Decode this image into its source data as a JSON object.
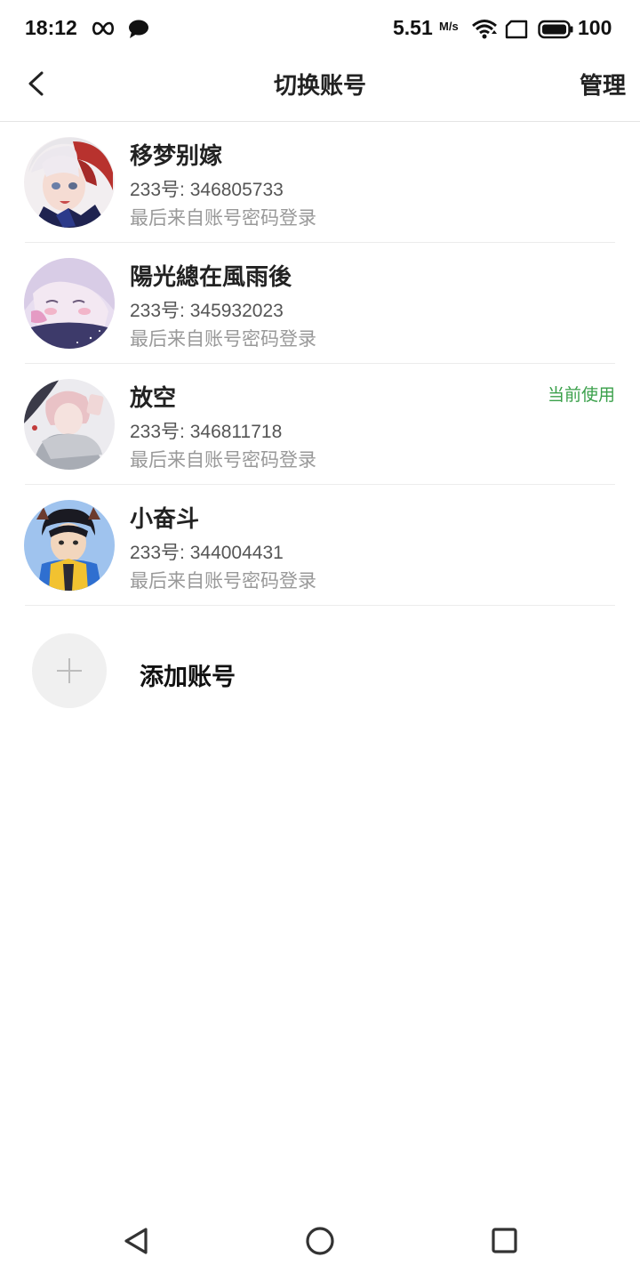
{
  "status_bar": {
    "time": "18:12",
    "speed": "5.51",
    "speed_unit": "M/s",
    "battery": "100",
    "icons": [
      "infinity-icon",
      "chat-bubble-icon",
      "wifi-icon",
      "sim-card-icon",
      "battery-icon"
    ]
  },
  "header": {
    "title": "切换账号",
    "manage_label": "管理",
    "back_icon": "chevron-left-icon"
  },
  "accounts": [
    {
      "name": "移梦别嫁",
      "id_text": "233号: 346805733",
      "login_text": "最后来自账号密码登录",
      "current": ""
    },
    {
      "name": "陽光總在風雨後",
      "id_text": "233号: 345932023",
      "login_text": "最后来自账号密码登录",
      "current": ""
    },
    {
      "name": "放空",
      "id_text": "233号: 346811718",
      "login_text": "最后来自账号密码登录",
      "current": "当前使用"
    },
    {
      "name": "小奋斗",
      "id_text": "233号: 344004431",
      "login_text": "最后来自账号密码登录",
      "current": ""
    }
  ],
  "add_account": {
    "label": "添加账号",
    "icon": "plus-icon"
  },
  "colors": {
    "accent_green": "#3aa04a",
    "divider": "#ececec",
    "muted": "#999999"
  },
  "nav_bar": {
    "icons": [
      "back-triangle-icon",
      "home-circle-icon",
      "recents-square-icon"
    ]
  }
}
